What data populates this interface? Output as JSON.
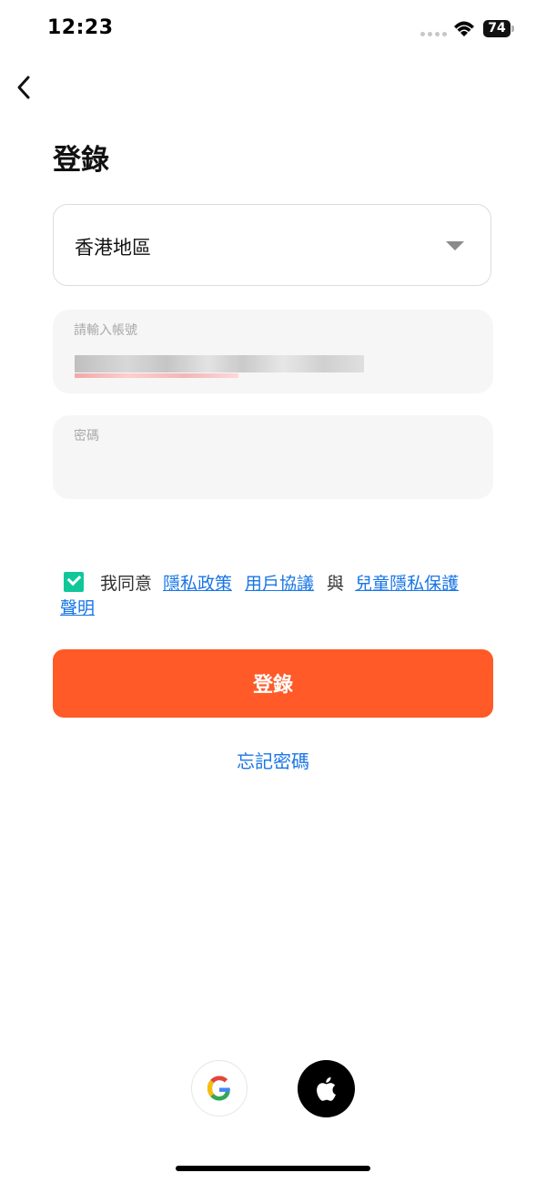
{
  "status_bar": {
    "time": "12:23",
    "battery": "74"
  },
  "header": {
    "back_icon": "chevron-left-icon",
    "title": "登錄"
  },
  "region": {
    "value": "香港地區",
    "icon": "chevron-down-icon"
  },
  "account": {
    "label": "請輸入帳號"
  },
  "password": {
    "label": "密碼"
  },
  "agreement": {
    "checked": true,
    "prefix": "我同意",
    "privacy_link": "隱私政策",
    "terms_link": "用戶協議",
    "and_text": "與",
    "child_privacy_link_part1": "兒童隱私保護",
    "child_privacy_link_part2": "聲明"
  },
  "login_button": {
    "label": "登錄"
  },
  "forgot_password": {
    "label": "忘記密碼"
  },
  "social_login": {
    "google_icon": "google-icon",
    "apple_icon": "apple-icon"
  },
  "colors": {
    "accent": "#ff5a28",
    "link": "#1976e6",
    "checkbox": "#10c79a"
  }
}
